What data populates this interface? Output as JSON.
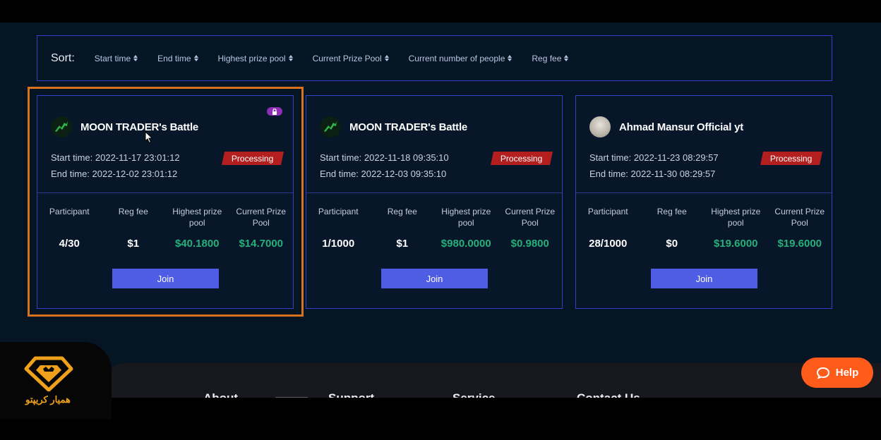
{
  "sort": {
    "label": "Sort:",
    "options": [
      "Start time",
      "End time",
      "Highest prize pool",
      "Current Prize Pool",
      "Current number of people",
      "Reg fee"
    ]
  },
  "stat_labels": {
    "participant": "Participant",
    "reg_fee": "Reg fee",
    "highest_prize_pool": "Highest prize pool",
    "current_prize_pool": "Current Prize Pool"
  },
  "cards": [
    {
      "title": "MOON TRADER's Battle",
      "locked": true,
      "start_label": "Start time:",
      "start_time": "2022-11-17 23:01:12",
      "end_label": "End time:",
      "end_time": "2022-12-02 23:01:12",
      "status": "Processing",
      "participant": "4/30",
      "reg_fee": "$1",
      "highest_prize_pool": "$40.1800",
      "current_prize_pool": "$14.7000",
      "join_label": "Join"
    },
    {
      "title": "MOON TRADER's Battle",
      "locked": false,
      "start_label": "Start time:",
      "start_time": "2022-11-18 09:35:10",
      "end_label": "End time:",
      "end_time": "2022-12-03 09:35:10",
      "status": "Processing",
      "participant": "1/1000",
      "reg_fee": "$1",
      "highest_prize_pool": "$980.0000",
      "current_prize_pool": "$0.9800",
      "join_label": "Join"
    },
    {
      "title": "Ahmad Mansur Official yt",
      "locked": false,
      "start_label": "Start time:",
      "start_time": "2022-11-23 08:29:57",
      "end_label": "End time:",
      "end_time": "2022-11-30 08:29:57",
      "status": "Processing",
      "participant": "28/1000",
      "reg_fee": "$0",
      "highest_prize_pool": "$19.6000",
      "current_prize_pool": "$19.6000",
      "join_label": "Join"
    }
  ],
  "footer": {
    "links": [
      "About",
      "Support",
      "Service",
      "Contact Us"
    ]
  },
  "watermark": {
    "text": "همیار کریپتو"
  },
  "help_button": {
    "label": "Help"
  },
  "colors": {
    "accent_blue": "#4f5de4",
    "border_blue": "#3340c9",
    "status_red": "#b31e1e",
    "prize_green": "#26b07a",
    "highlight_orange": "#d9721d",
    "help_orange": "#ff5b1a"
  }
}
